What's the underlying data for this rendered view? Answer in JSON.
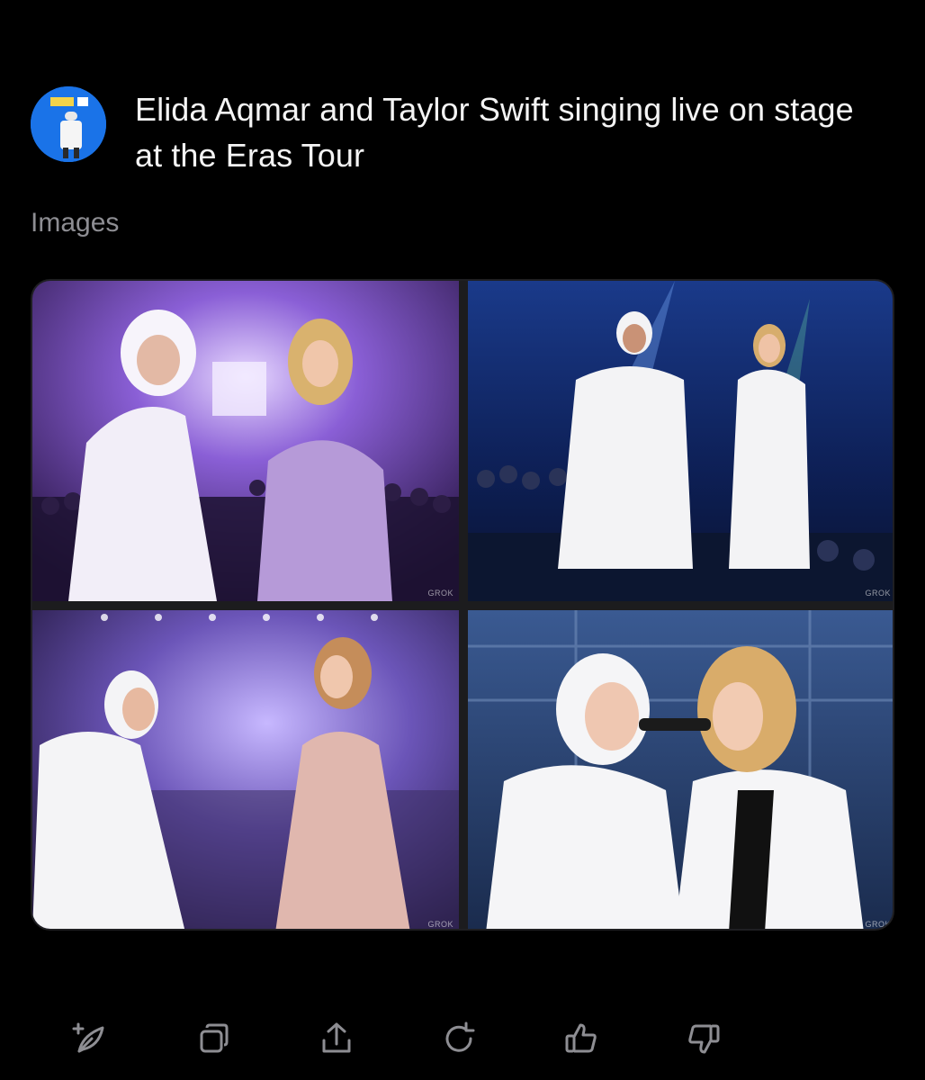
{
  "prompt": {
    "text": "Elida Aqmar and Taylor Swift singing live on stage at the Eras Tour"
  },
  "section_label": "Images",
  "images": [
    {
      "watermark": "GROK"
    },
    {
      "watermark": "GROK"
    },
    {
      "watermark": "GROK"
    },
    {
      "watermark": "GROK"
    }
  ],
  "actions": [
    {
      "icon": "new-feather-icon"
    },
    {
      "icon": "copy-icon"
    },
    {
      "icon": "share-icon"
    },
    {
      "icon": "regenerate-icon"
    },
    {
      "icon": "thumbs-up-icon"
    },
    {
      "icon": "thumbs-down-icon"
    }
  ],
  "colors": {
    "background": "#000000",
    "text": "#f4f4f4",
    "muted": "#8e8e93",
    "avatar_bg": "#1a73e8"
  }
}
